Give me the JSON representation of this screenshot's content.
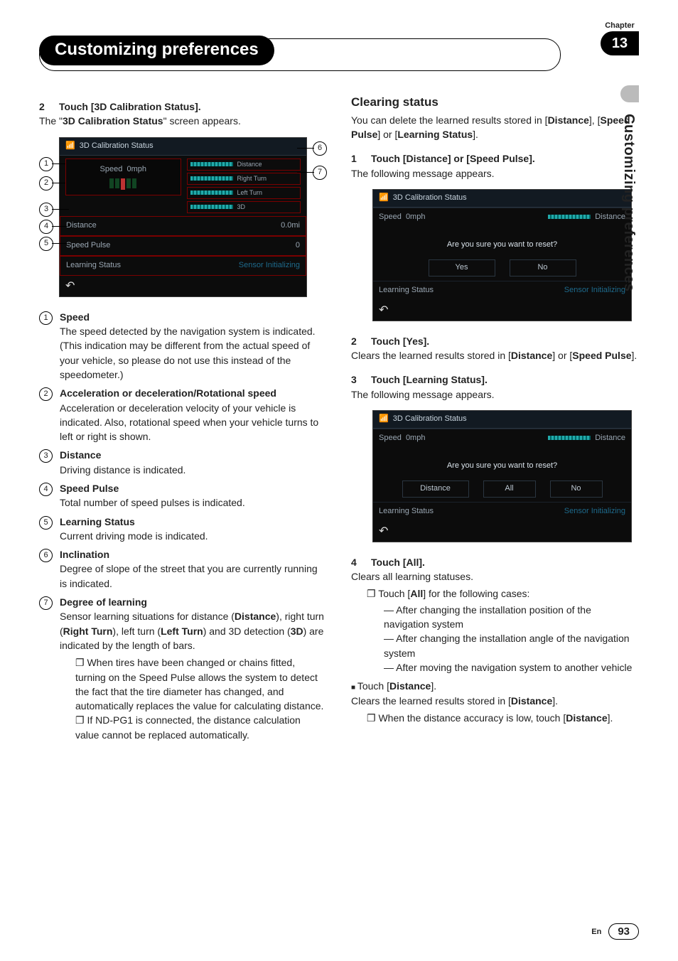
{
  "chapter": {
    "label": "Chapter",
    "number": "13",
    "side": "Customizing preferences"
  },
  "title": "Customizing preferences",
  "footer": {
    "lang": "En",
    "page": "93"
  },
  "left": {
    "step2": {
      "num": "2",
      "text": "Touch [3D Calibration Status]."
    },
    "step2_body_pre": "The \"",
    "step2_body_bold": "3D Calibration Status",
    "step2_body_post": "\" screen appears.",
    "fig1": {
      "title": "3D Calibration Status",
      "speed_label": "Speed",
      "speed_val": "0mph",
      "bars": [
        "Distance",
        "Right Turn",
        "Left Turn",
        "3D"
      ],
      "rows": [
        {
          "k": "Distance",
          "v": "0.0mi"
        },
        {
          "k": "Speed Pulse",
          "v": "0"
        },
        {
          "k": "Learning Status",
          "v": "Sensor Initializing"
        }
      ],
      "callouts": [
        "1",
        "2",
        "3",
        "4",
        "5",
        "6",
        "7"
      ]
    },
    "legend": [
      {
        "n": "1",
        "title": "Speed",
        "body": "The speed detected by the navigation system is indicated. (This indication may be different from the actual speed of your vehicle, so please do not use this instead of the speedometer.)"
      },
      {
        "n": "2",
        "title": "Acceleration or deceleration/Rotational speed",
        "body": "Acceleration or deceleration velocity of your vehicle is indicated. Also, rotational speed when your vehicle turns to left or right is shown."
      },
      {
        "n": "3",
        "title": "Distance",
        "body": "Driving distance is indicated."
      },
      {
        "n": "4",
        "title": "Speed Pulse",
        "body": "Total number of speed pulses is indicated."
      },
      {
        "n": "5",
        "title": "Learning Status",
        "body": "Current driving mode is indicated."
      },
      {
        "n": "6",
        "title": "Inclination",
        "body": "Degree of slope of the street that you are currently running is indicated."
      },
      {
        "n": "7",
        "title": "Degree of learning",
        "body_parts": [
          "Sensor learning situations for distance (",
          "Distance",
          "), right turn (",
          "Right Turn",
          "), left turn (",
          "Left Turn",
          ") and 3D detection (",
          "3D",
          ") are indicated by the length of bars."
        ],
        "notes": [
          "When tires have been changed or chains fitted, turning on the Speed Pulse allows the system to detect the fact that the tire diameter has changed, and automatically replaces the value for calculating distance.",
          "If ND-PG1 is connected, the distance calculation value cannot be replaced automatically."
        ]
      }
    ]
  },
  "right": {
    "h_clear": "Clearing status",
    "clear_intro_parts": [
      "You can delete the learned results stored in [",
      "Distance",
      "], [",
      "Speed Pulse",
      "] or [",
      "Learning Status",
      "]."
    ],
    "step1": {
      "num": "1",
      "text": "Touch [Distance] or [Speed Pulse]."
    },
    "step1_body": "The following message appears.",
    "fig2": {
      "title": "3D Calibration Status",
      "speed_label": "Speed",
      "speed_val": "0mph",
      "right_lbl": "Distance",
      "dialog": "Are you sure you want to reset?",
      "btns": [
        "Yes",
        "No"
      ],
      "bottom": {
        "k": "Learning Status",
        "v": "Sensor Initializing"
      }
    },
    "step2": {
      "num": "2",
      "text": "Touch [Yes]."
    },
    "step2_body_parts": [
      "Clears the learned results stored in [",
      "Distance",
      "] or [",
      "Speed Pulse",
      "]."
    ],
    "step3": {
      "num": "3",
      "text": "Touch [Learning Status]."
    },
    "step3_body": "The following message appears.",
    "fig3": {
      "title": "3D Calibration Status",
      "speed_label": "Speed",
      "speed_val": "0mph",
      "right_lbl": "Distance",
      "dialog": "Are you sure you want to reset?",
      "btns": [
        "Distance",
        "All",
        "No"
      ],
      "bottom": {
        "k": "Learning Status",
        "v": "Sensor Initializing"
      }
    },
    "step4": {
      "num": "4",
      "text": "Touch [All]."
    },
    "step4_line": "Clears all learning statuses.",
    "step4_note_parts": [
      "Touch [",
      "All",
      "] for the following cases:"
    ],
    "step4_cases": [
      "After changing the installation position of the navigation system",
      "After changing the installation angle of the navigation system",
      "After moving the navigation system to another vehicle"
    ],
    "touch_distance_parts": [
      "Touch [",
      "Distance",
      "]."
    ],
    "touch_distance_body_parts": [
      "Clears the learned results stored in [",
      "Distance",
      "]."
    ],
    "touch_distance_note_parts": [
      "When the distance accuracy is low, touch [",
      "Distance",
      "]."
    ]
  }
}
